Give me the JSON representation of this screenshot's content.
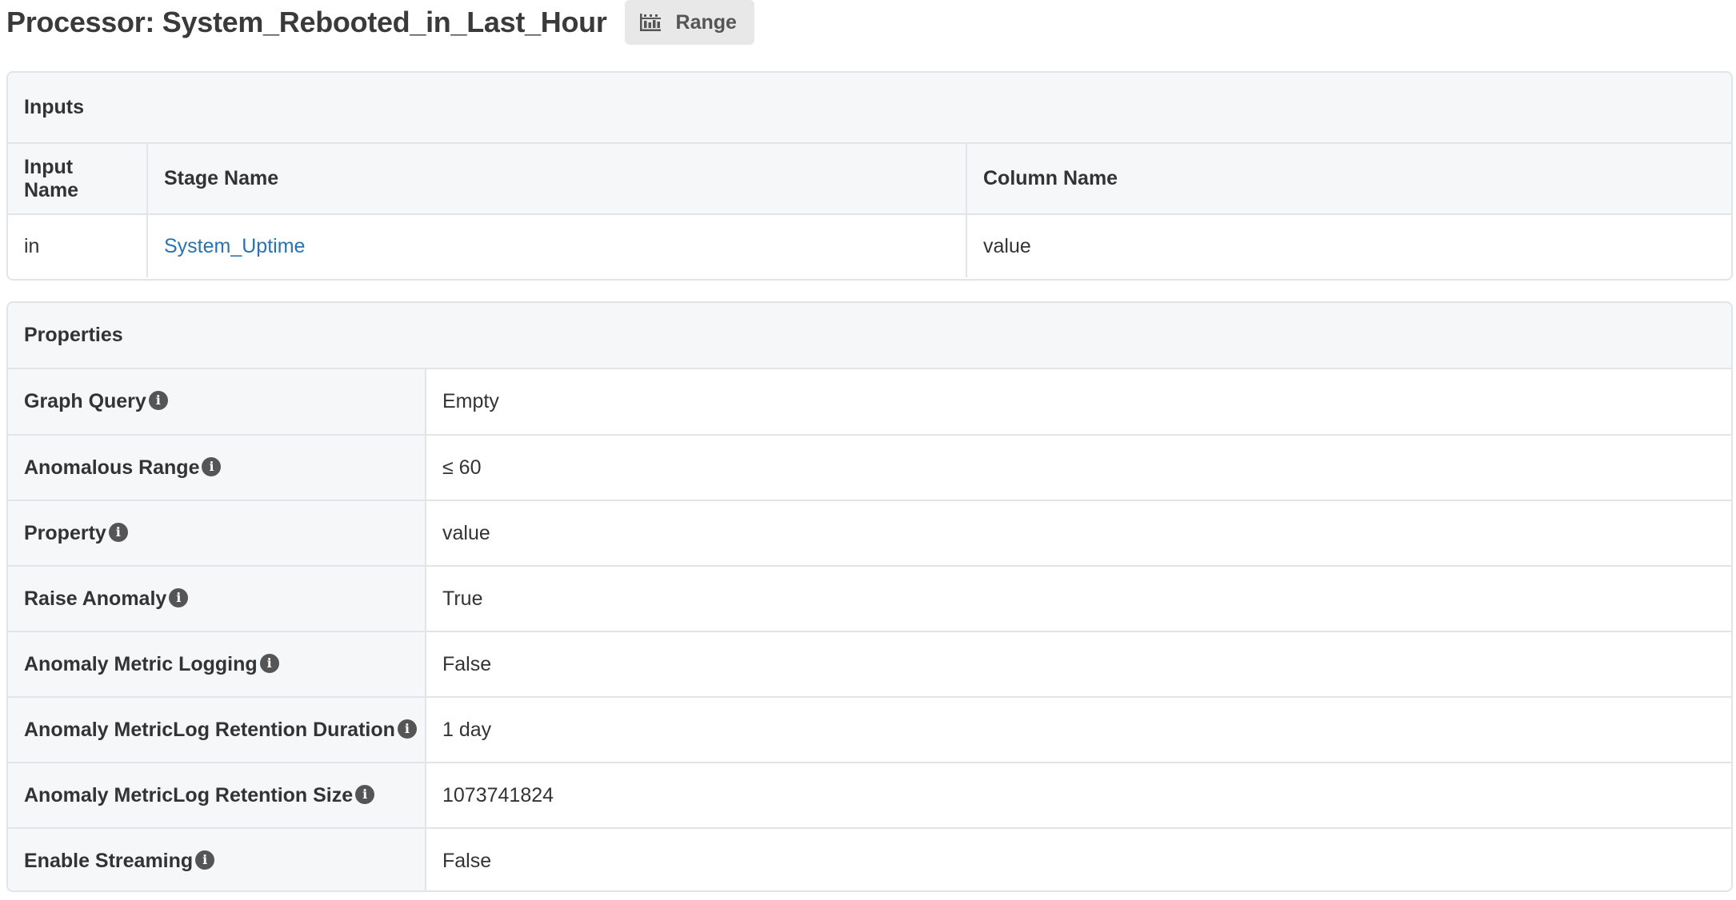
{
  "header": {
    "title": "Processor: System_Rebooted_in_Last_Hour",
    "badge": {
      "icon": "range-chart-icon",
      "label": "Range"
    }
  },
  "inputs": {
    "heading": "Inputs",
    "columns": [
      "Input Name",
      "Stage Name",
      "Column Name"
    ],
    "rows": [
      {
        "input_name": "in",
        "stage_name": "System_Uptime",
        "column_name": "value"
      }
    ]
  },
  "properties": {
    "heading": "Properties",
    "info_icon": "info-icon",
    "rows": [
      {
        "key": "Graph Query",
        "value": "Empty"
      },
      {
        "key": "Anomalous Range",
        "value": "≤ 60"
      },
      {
        "key": "Property",
        "value": "value"
      },
      {
        "key": "Raise Anomaly",
        "value": "True"
      },
      {
        "key": "Anomaly Metric Logging",
        "value": "False"
      },
      {
        "key": "Anomaly MetricLog Retention Duration",
        "value": "1 day"
      },
      {
        "key": "Anomaly MetricLog Retention Size",
        "value": "1073741824"
      },
      {
        "key": "Enable Streaming",
        "value": "False"
      }
    ]
  },
  "colors": {
    "link": "#2a72b0",
    "border": "#e2e5e8",
    "heading_bg": "#f6f7f8",
    "badge_bg": "#e8e8e8"
  }
}
